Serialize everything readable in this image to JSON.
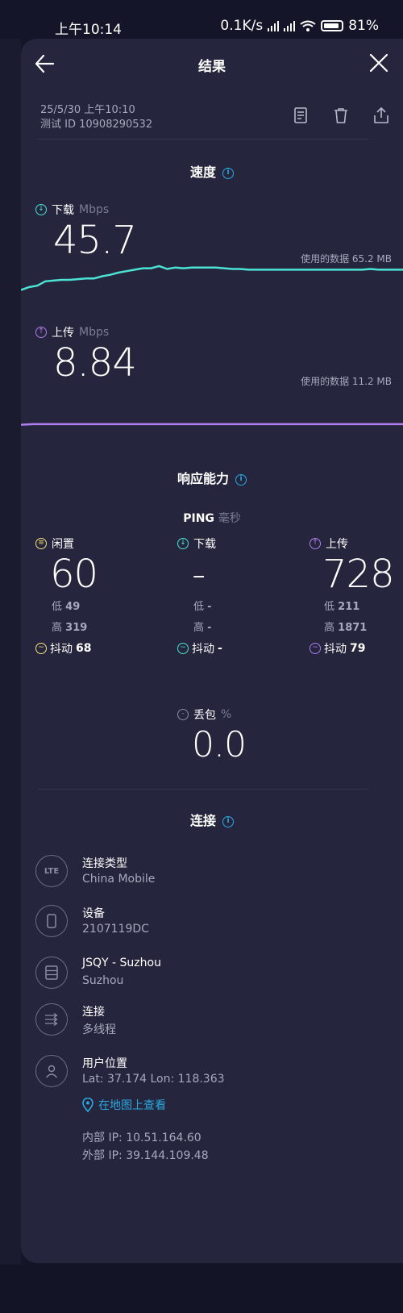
{
  "status_bar": {
    "time": "上午10:14",
    "speed": "0.1K/s",
    "battery": "81%"
  },
  "header": {
    "title": "结果"
  },
  "test": {
    "date": "25/5/30 上午10:10",
    "test_id": "测试 ID 10908290532"
  },
  "speed": {
    "section_title": "速度",
    "download": {
      "label": "下载",
      "unit": "Mbps",
      "value": "45.7",
      "data_used": "使用的数据 65.2 MB",
      "series": [
        36,
        40,
        42,
        48,
        49,
        50,
        50,
        51,
        52,
        52,
        55,
        57,
        60,
        62,
        64,
        66,
        66,
        69,
        65,
        67,
        66,
        67,
        67,
        67,
        67,
        66,
        65,
        65,
        64,
        64,
        64,
        64,
        64,
        64,
        64,
        64,
        64,
        64,
        64,
        64,
        64,
        64,
        64,
        65,
        64,
        64,
        64,
        64
      ]
    },
    "upload": {
      "label": "上传",
      "unit": "Mbps",
      "value": "8.84",
      "data_used": "使用的数据 11.2 MB",
      "series": [
        8,
        9,
        9,
        9,
        9,
        9,
        9,
        9,
        9,
        9,
        9,
        9,
        9,
        9,
        9,
        9,
        9,
        9,
        9,
        9,
        9,
        9,
        9,
        9,
        9,
        9,
        9,
        9,
        9,
        9,
        9,
        9
      ]
    }
  },
  "responsiveness": {
    "section_title": "响应能力",
    "ping_label": "PING",
    "ping_unit": "毫秒",
    "idle": {
      "label": "闲置",
      "value": "60",
      "low_label": "低",
      "low": "49",
      "high_label": "高",
      "high": "319",
      "jitter_label": "抖动",
      "jitter": "68"
    },
    "download": {
      "label": "下载",
      "value": "-",
      "low_label": "低",
      "low": "-",
      "high_label": "高",
      "high": "-",
      "jitter_label": "抖动",
      "jitter": "-"
    },
    "upload": {
      "label": "上传",
      "value": "728",
      "low_label": "低",
      "low": "211",
      "high_label": "高",
      "high": "1871",
      "jitter_label": "抖动",
      "jitter": "79"
    },
    "packet_loss_label": "丢包",
    "packet_loss_unit": "%",
    "packet_loss_value": "0.0"
  },
  "connection": {
    "section_title": "连接",
    "items": [
      {
        "icon": "lte-icon",
        "icon_text": "LTE",
        "title": "连接类型",
        "subtitle": "China Mobile"
      },
      {
        "icon": "phone-icon",
        "title": "设备",
        "subtitle": "2107119DC"
      },
      {
        "icon": "server-icon",
        "title": "JSQY - Suzhou",
        "subtitle": "Suzhou"
      },
      {
        "icon": "multi-thread-icon",
        "title": "连接",
        "subtitle": "多线程"
      },
      {
        "icon": "user-icon",
        "title": "用户位置",
        "subtitle": "Lat: 37.174 Lon: 118.363"
      }
    ],
    "map_link": "在地图上查看",
    "internal_ip": "内部 IP: 10.51.164.60",
    "external_ip": "外部 IP: 39.144.109.48"
  },
  "colors": {
    "download": "#4be3d4",
    "upload": "#b07ef0",
    "idle": "#f3e27a",
    "info": "#29a9e1"
  }
}
